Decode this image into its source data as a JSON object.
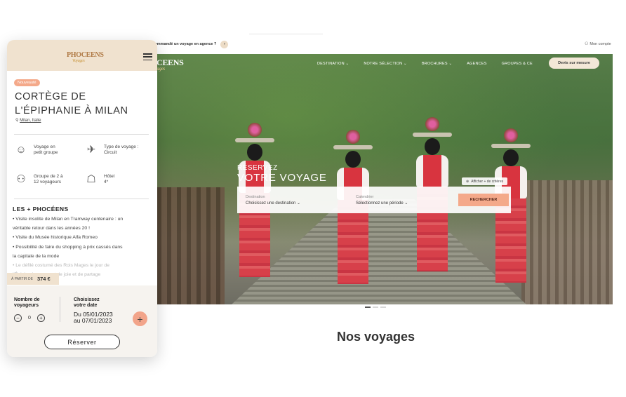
{
  "desktop": {
    "announcement": "z commandé un voyage en agence ?",
    "announcement_arrow": "›",
    "account": "Mon compte",
    "logo_main": "OCEENS",
    "logo_sub": "Voyages",
    "nav": [
      "DESTINATION ⌄",
      "NOTRE SÉLECTION ⌄",
      "BROCHURES ⌄",
      "AGENCES",
      "GROUPES & CE"
    ],
    "devis_button": "Devis sur mesure",
    "hero_kicker": "RÉSERVEZ",
    "hero_title": "VOTRE VOYAGE",
    "criteria_button": "Afficher + de critères",
    "search": {
      "destination_label": "Destination",
      "destination_value": "Choisissez une destination ⌄",
      "calendar_label": "Calendrier",
      "calendar_value": "Sélectionnez une période ⌄",
      "submit": "RECHERCHER"
    },
    "section_title": "Nos voyages"
  },
  "mobile": {
    "logo_main": "PHOCEENS",
    "logo_sub": "Voyages",
    "badge": "Nouveauté",
    "title_line1": "CORTÈGE DE",
    "title_line2": "L'ÉPIPHANIE À MILAN",
    "location_pin": "⚲",
    "location": "Milan, Italie",
    "features": [
      {
        "icon": "group-icon",
        "text_line1": "Voyage en",
        "text_line2": "petit groupe"
      },
      {
        "icon": "plane-icon",
        "text_line1": "Type de voyage :",
        "text_line2": "Circuit"
      },
      {
        "icon": "people-icon",
        "text_line1": "Groupe de 2 à",
        "text_line2": "12 voyageurs"
      },
      {
        "icon": "hotel-icon",
        "text_line1": "Hôtel",
        "text_line2": "4*"
      }
    ],
    "plus_heading": "LES + PHOCÉENS",
    "plus_items": [
      "• Visite insolite de Milan en Tramway centenaire : un",
      "véritable retour dans les années 20 !",
      "• Visite du Musée historique Alfa Romeo",
      "• Possibilité de faire du shopping à prix cassés dans",
      "la capitale de la mode",
      "• Le défilé costumé des Rois Mages le jour de",
      "l'Épiphanie, moment de joie et de partage"
    ],
    "price_prefix": "À PARTIR DE",
    "price": "374 €",
    "travelers_label_line1": "Nombre de",
    "travelers_label_line2": "voyageurs",
    "travelers_count": "0",
    "date_label_line1": "Choisissez",
    "date_label_line2": "votre date",
    "date_line1": "Du 05/01/2023",
    "date_line2": "au 07/01/2023",
    "reserve_button": "Réserver"
  },
  "colors": {
    "accent": "#f4a98a",
    "sand": "#f0e2cf",
    "text": "#2b2b2b"
  }
}
